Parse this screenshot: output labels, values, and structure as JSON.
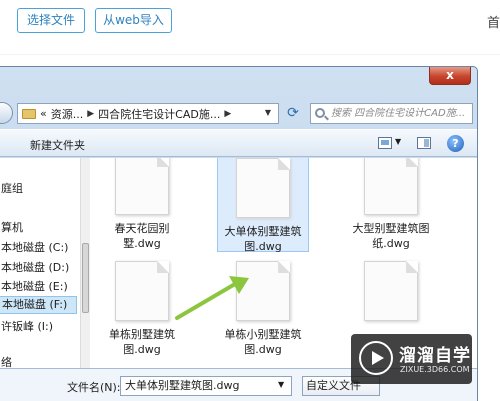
{
  "web": {
    "select_file": "选择文件",
    "from_web": "从web导入",
    "home_link": "首"
  },
  "dialog": {
    "close": "x",
    "breadcrumbs": [
      "«",
      "资源...",
      "四合院住宅设计CAD施..."
    ],
    "search_placeholder": "搜索 四合院住宅设计CAD施...",
    "toolbar": {
      "new_folder": "新建文件夹",
      "help": "?"
    },
    "sidebar": [
      {
        "label": "庭组"
      },
      {
        "label": "算机"
      },
      {
        "label": "本地磁盘 (C:)"
      },
      {
        "label": "本地磁盘 (D:)"
      },
      {
        "label": "本地磁盘 (E:)"
      },
      {
        "label": "本地磁盘 (F:)"
      },
      {
        "label": "许钣峰 (I:)"
      },
      {
        "label": "络"
      }
    ],
    "files": [
      {
        "name": "春天花园别墅.dwg"
      },
      {
        "name": "大单体别墅建筑图.dwg"
      },
      {
        "name": "大型别墅建筑图纸.dwg"
      },
      {
        "name": "单栋别墅建筑图.dwg"
      },
      {
        "name": "单栋小别墅建筑图.dwg"
      },
      {
        "name": ""
      }
    ],
    "filename_label": "文件名(N):",
    "filename_value": "大单体别墅建筑图.dwg",
    "filetype_value": "自定义文件"
  },
  "watermark": {
    "title": "溜溜自学",
    "subtitle": "ZIXUE.3D66.COM"
  },
  "colors": {
    "accent": "#2d82c0",
    "selection": "#dcecfc",
    "arrow": "#8cc63f"
  }
}
